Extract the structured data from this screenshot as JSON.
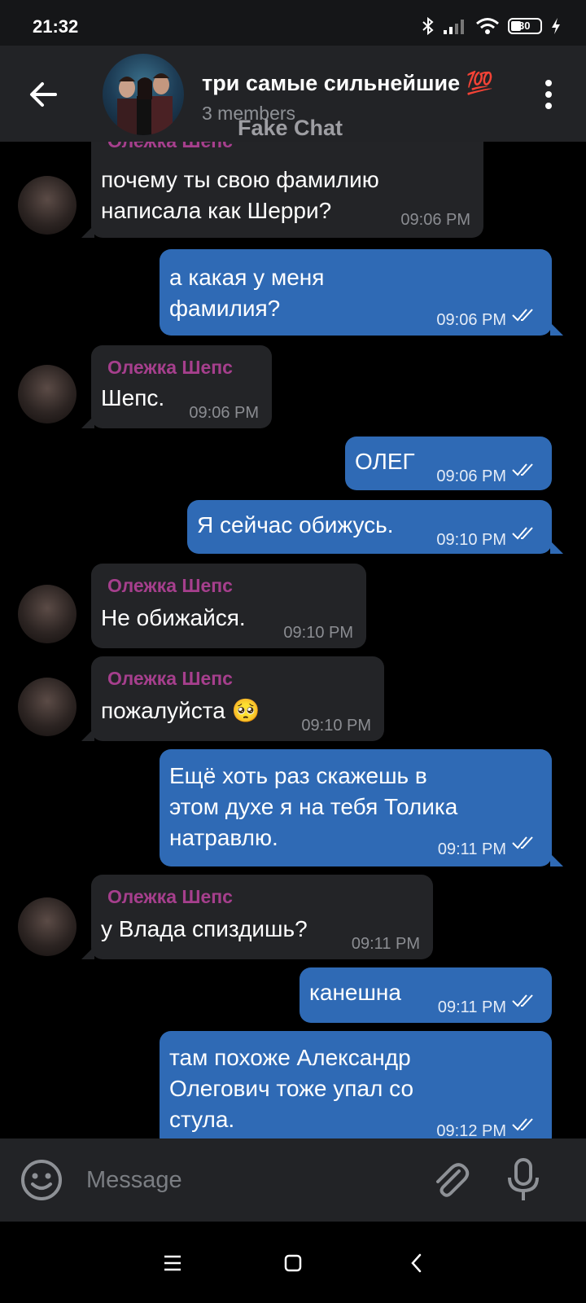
{
  "status_bar": {
    "time": "21:32",
    "battery": "30"
  },
  "header": {
    "title": "три самые сильнейшие 💯",
    "subtitle": "3 members",
    "watermark": "Fake Chat"
  },
  "messages": [
    {
      "dir": "in",
      "sender": "Олежка Шепс",
      "lines": [
        "почему ты свою фамилию",
        "написала как Шерри?"
      ],
      "time": "09:06 PM"
    },
    {
      "dir": "out",
      "lines": [
        "а какая у меня",
        "фамилия?"
      ],
      "time": "09:06 PM"
    },
    {
      "dir": "in",
      "sender": "Олежка Шепс",
      "lines": [
        "Шепс."
      ],
      "time": "09:06 PM"
    },
    {
      "dir": "out",
      "lines": [
        "ОЛЕГ"
      ],
      "time": "09:06 PM"
    },
    {
      "dir": "out",
      "lines": [
        "Я сейчас обижусь."
      ],
      "time": "09:10 PM"
    },
    {
      "dir": "in",
      "sender": "Олежка Шепс",
      "lines": [
        "Не обижайся."
      ],
      "time": "09:10 PM"
    },
    {
      "dir": "in",
      "sender": "Олежка Шепс",
      "lines": [
        "пожалуйста 🥺"
      ],
      "time": "09:10 PM"
    },
    {
      "dir": "out",
      "lines": [
        "Ещё хоть раз скажешь в",
        "этом духе я на тебя Толика",
        "натравлю."
      ],
      "time": "09:11 PM"
    },
    {
      "dir": "in",
      "sender": "Олежка Шепс",
      "lines": [
        "у Влада спиздишь?"
      ],
      "time": "09:11 PM"
    },
    {
      "dir": "out",
      "lines": [
        "канешна"
      ],
      "time": "09:11 PM"
    },
    {
      "dir": "out",
      "lines": [
        "там похоже Александр",
        "Олегович тоже упал со",
        "стула."
      ],
      "time": "09:12 PM"
    }
  ],
  "input": {
    "placeholder": "Message"
  },
  "icons": {
    "back": "arrow-left-icon",
    "menu": "more-vert-icon",
    "emoji": "emoji-icon",
    "attach": "paperclip-icon",
    "mic": "microphone-icon",
    "nav_menu": "menu-icon",
    "nav_home": "home-icon",
    "nav_back": "back-chevron-icon"
  },
  "colors": {
    "incoming_bubble": "#232427",
    "outgoing_bubble": "#2f6ab5",
    "sender_name": "#a63f8d",
    "header_bg": "#222326"
  }
}
